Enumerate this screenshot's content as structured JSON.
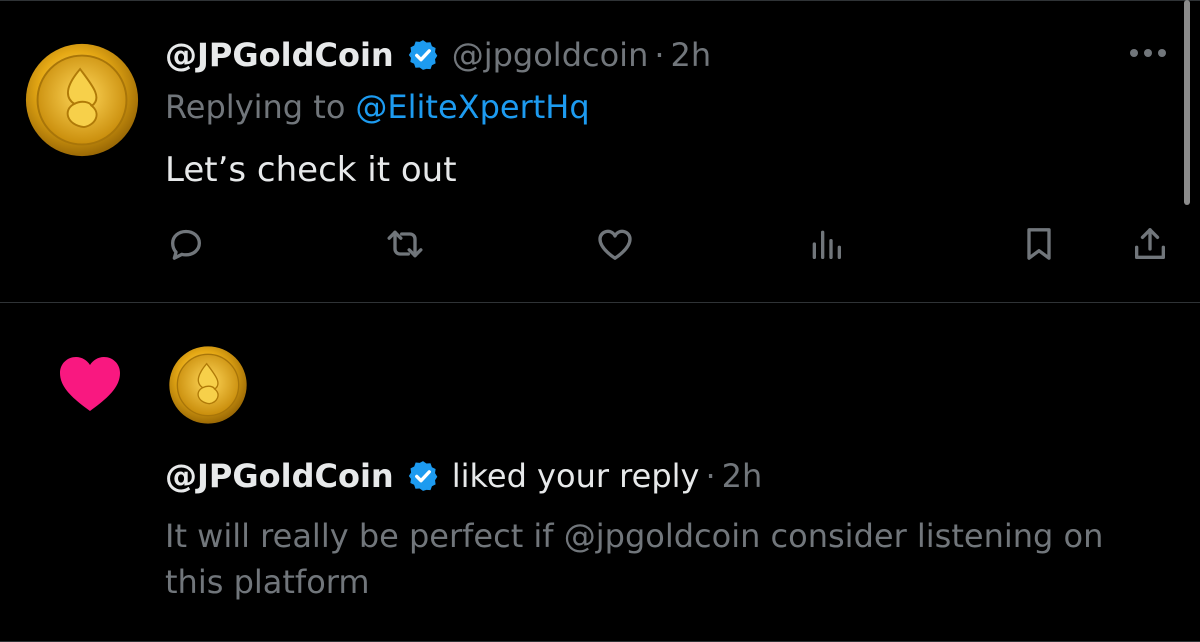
{
  "tweet": {
    "display_name": "@JPGoldCoin",
    "handle": "@jpgoldcoin",
    "separator": "·",
    "time": "2h",
    "replying_prefix": "Replying to",
    "replying_to": "@EliteXpertHq",
    "text": "Let’s check it out",
    "actions": [
      "reply-icon",
      "retweet-icon",
      "like-icon",
      "views-icon",
      "bookmark-icon",
      "share-icon"
    ]
  },
  "notification": {
    "display_name": "@JPGoldCoin",
    "action_text": "liked your reply",
    "separator": "·",
    "time": "2h",
    "reply_text": "It will really be perfect if @jpgoldcoin consider listening on this platform"
  },
  "colors": {
    "background": "#000000",
    "primary_text": "#e7e9ea",
    "secondary_text": "#71767b",
    "accent_blue": "#1d9bf0",
    "like_pink": "#f91880",
    "divider": "#2f3336",
    "coin_gold": "#e6a915"
  },
  "icons": {
    "avatar": "jpgoldcoin-coin-avatar",
    "verified": "verified-badge-icon",
    "more": "more-options-icon",
    "notification": "heart-icon"
  }
}
